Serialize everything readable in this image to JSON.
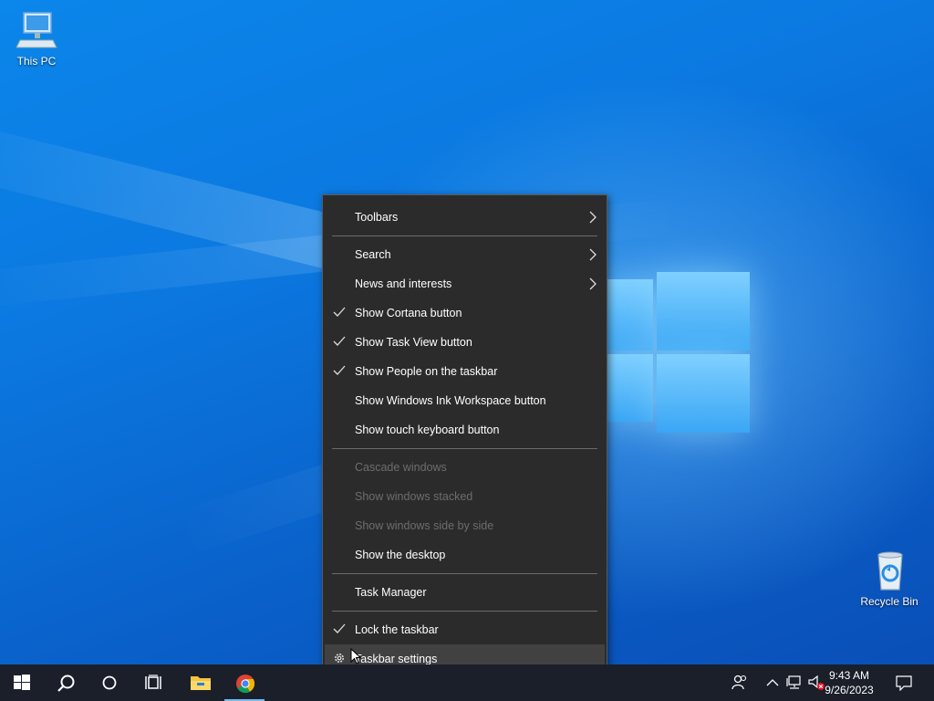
{
  "desktop": {
    "icons": [
      {
        "label": "This PC",
        "icon": "computer-icon"
      },
      {
        "label": "Recycle Bin",
        "icon": "recycle-bin-icon"
      }
    ]
  },
  "context_menu": {
    "items": {
      "toolbars": {
        "label": "Toolbars",
        "submenu": true
      },
      "search": {
        "label": "Search",
        "submenu": true
      },
      "news": {
        "label": "News and interests",
        "submenu": true
      },
      "cortana": {
        "label": "Show Cortana button",
        "checked": true
      },
      "task_view": {
        "label": "Show Task View button",
        "checked": true
      },
      "people": {
        "label": "Show People on the taskbar",
        "checked": true
      },
      "ink": {
        "label": "Show Windows Ink Workspace button",
        "checked": false
      },
      "touch_keyboard": {
        "label": "Show touch keyboard button",
        "checked": false
      },
      "cascade": {
        "label": "Cascade windows",
        "disabled": true
      },
      "stacked": {
        "label": "Show windows stacked",
        "disabled": true
      },
      "side_by_side": {
        "label": "Show windows side by side",
        "disabled": true
      },
      "show_desktop": {
        "label": "Show the desktop"
      },
      "task_manager": {
        "label": "Task Manager"
      },
      "lock": {
        "label": "Lock the taskbar",
        "checked": true
      },
      "settings": {
        "label": "Taskbar settings",
        "icon": "gear-icon"
      }
    }
  },
  "taskbar": {
    "buttons": [
      "start-icon",
      "search-icon",
      "cortana-icon",
      "task-view-icon",
      "file-explorer-icon",
      "chrome-icon"
    ],
    "tray_icons": [
      "people-icon",
      "chevron-up-icon",
      "network-icon",
      "volume-muted-icon",
      "notification-icon"
    ],
    "clock": {
      "time": "9:43 AM",
      "date": "9/26/2023"
    }
  },
  "colors": {
    "menu_bg": "#2b2b2b",
    "menu_hover": "#414141",
    "taskbar_bg": "#1a1f2a",
    "accent": "#76b9ed",
    "desktop_blue": "#0b78e0"
  }
}
